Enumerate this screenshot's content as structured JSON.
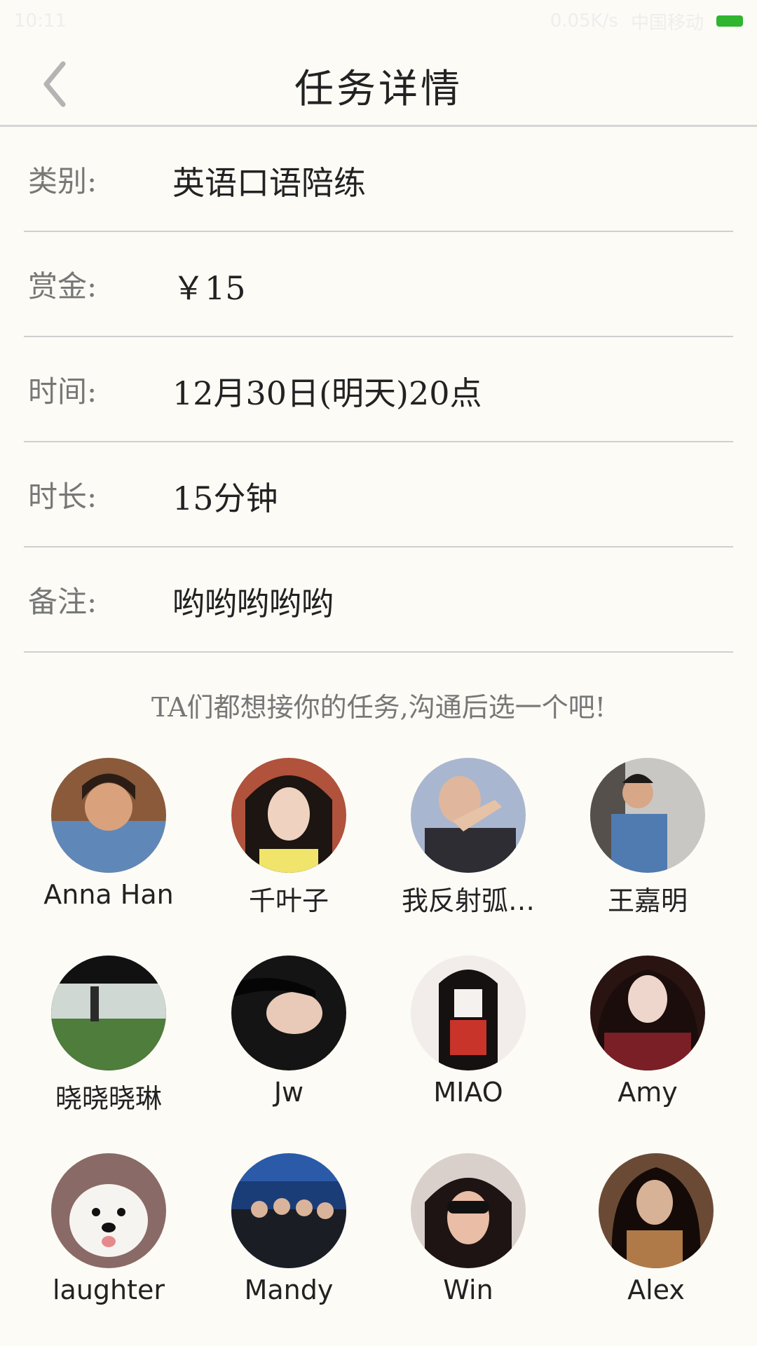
{
  "status_bar": {
    "time": "10:11",
    "network": "0.05K/s",
    "carrier": "中国移动"
  },
  "header": {
    "back_icon": "chevron-left-icon",
    "title": "任务详情"
  },
  "details": [
    {
      "label": "类别:",
      "value": "英语口语陪练"
    },
    {
      "label": "赏金:",
      "value": "￥15"
    },
    {
      "label": "时间:",
      "value": "12月30日(明天)20点"
    },
    {
      "label": "时长:",
      "value": "15分钟"
    },
    {
      "label": "备注:",
      "value": "哟哟哟哟哟"
    }
  ],
  "hint": "TA们都想接你的任务,沟通后选一个吧!",
  "applicants": [
    {
      "name": "Anna Han"
    },
    {
      "name": "千叶子"
    },
    {
      "name": "我反射弧…"
    },
    {
      "name": "王嘉明"
    },
    {
      "name": "晓晓晓琳"
    },
    {
      "name": "Jw"
    },
    {
      "name": "MIAO"
    },
    {
      "name": "Amy"
    },
    {
      "name": "laughter"
    },
    {
      "name": "Mandy"
    },
    {
      "name": "Win"
    },
    {
      "name": "Alex"
    }
  ],
  "colors": {
    "background": "#fcfbf6",
    "divider": "#cfcfcf",
    "label": "#777777",
    "battery": "#2fb52f"
  }
}
